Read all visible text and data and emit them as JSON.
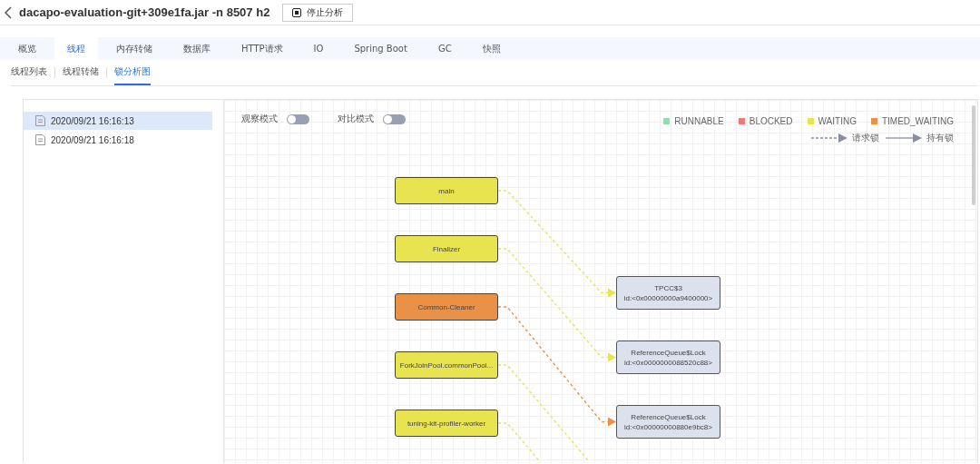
{
  "header": {
    "title": "dacapo-evaluation-git+309e1fa.jar -n 8507 h2",
    "stop_button": "停止分析"
  },
  "tabs": [
    {
      "label": "概览",
      "selected": false
    },
    {
      "label": "线程",
      "selected": true
    },
    {
      "label": "内存转储",
      "selected": false
    },
    {
      "label": "数据库",
      "selected": false
    },
    {
      "label": "HTTP请求",
      "selected": false
    },
    {
      "label": "IO",
      "selected": false
    },
    {
      "label": "Spring Boot",
      "selected": false
    },
    {
      "label": "GC",
      "selected": false
    },
    {
      "label": "快照",
      "selected": false
    }
  ],
  "subtabs": [
    {
      "label": "线程列表",
      "selected": false
    },
    {
      "label": "线程转储",
      "selected": false
    },
    {
      "label": "锁分析图",
      "selected": true
    }
  ],
  "snapshots": [
    {
      "label": "2020/09/21 16:16:13",
      "selected": true
    },
    {
      "label": "2020/09/21 16:16:18",
      "selected": false
    }
  ],
  "toggles": [
    {
      "label": "观察模式",
      "on": false
    },
    {
      "label": "对比模式",
      "on": false
    }
  ],
  "legend": {
    "states": [
      {
        "label": "RUNNABLE",
        "color": "#8ee0a6"
      },
      {
        "label": "BLOCKED",
        "color": "#f07a7a"
      },
      {
        "label": "WAITING",
        "color": "#e8e450"
      },
      {
        "label": "TIMED_WAITING",
        "color": "#ea9148"
      }
    ],
    "arrows": [
      {
        "kind": "request",
        "label": "请求锁"
      },
      {
        "kind": "hold",
        "label": "持有锁"
      }
    ]
  },
  "threads": [
    {
      "name": "main",
      "color": "#e8e450"
    },
    {
      "name": "Finalizer",
      "color": "#e8e450"
    },
    {
      "name": "Common-Cleaner",
      "color": "#ea9148"
    },
    {
      "name": "ForkJoinPool.commonPool...",
      "color": "#e8e450"
    },
    {
      "name": "tuning-kit-profiler-worker",
      "color": "#e8e450"
    }
  ],
  "locks": [
    {
      "name": "TPCC$3",
      "id": "id:<0x00000000a9400000>"
    },
    {
      "name": "ReferenceQueue$Lock",
      "id": "id:<0x0000000088520c88>"
    },
    {
      "name": "ReferenceQueue$Lock",
      "id": "id:<0x00000000880e9bc8>"
    }
  ]
}
